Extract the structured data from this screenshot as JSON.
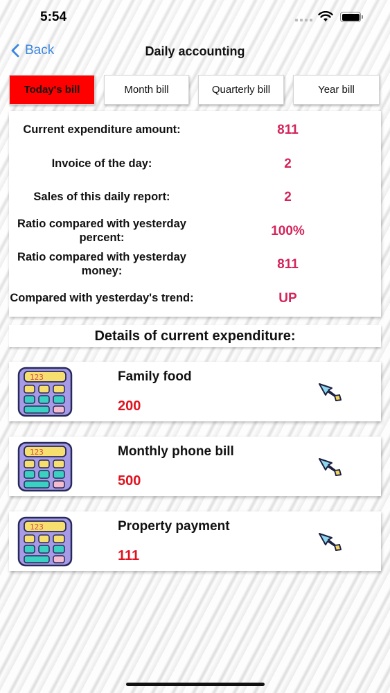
{
  "status_bar": {
    "time": "5:54"
  },
  "nav": {
    "back_label": "Back",
    "title": "Daily accounting"
  },
  "tabs": [
    {
      "label": "Today's bill",
      "active": true
    },
    {
      "label": "Month bill",
      "active": false
    },
    {
      "label": "Quarterly bill",
      "active": false
    },
    {
      "label": "Year bill",
      "active": false
    }
  ],
  "summary": [
    {
      "label": "Current expenditure amount:",
      "value": "811"
    },
    {
      "label": "Invoice of the day:",
      "value": "2"
    },
    {
      "label": "Sales of this daily report:",
      "value": "2"
    },
    {
      "label": "Ratio compared with yesterday percent:",
      "value": "100%"
    },
    {
      "label": "Ratio compared with yesterday money:",
      "value": "811"
    },
    {
      "label": "Compared with yesterday's trend:",
      "value": "UP"
    }
  ],
  "details_header": "Details of current expenditure:",
  "expenses": [
    {
      "title": "Family food",
      "amount": "200",
      "icon": "calculator-icon",
      "action_icon": "cursor-arrow-icon"
    },
    {
      "title": "Monthly phone bill",
      "amount": "500",
      "icon": "calculator-icon",
      "action_icon": "cursor-arrow-icon"
    },
    {
      "title": "Property payment",
      "amount": "111",
      "icon": "calculator-icon",
      "action_icon": "cursor-arrow-icon"
    }
  ],
  "calculator_display": "123",
  "colors": {
    "accent_blue": "#3a86e0",
    "active_tab": "#ff0000",
    "summary_value": "#d4245a",
    "amount_red": "#e0121e"
  }
}
